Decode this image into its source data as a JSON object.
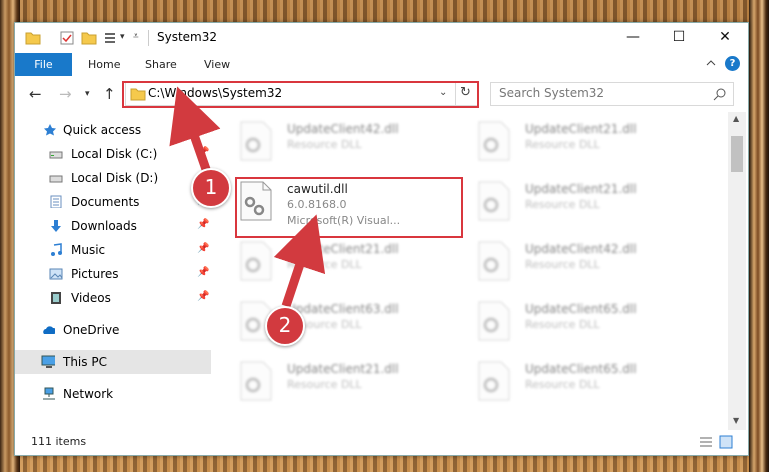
{
  "window": {
    "title": "System32",
    "controls": {
      "minimize": "—",
      "maximize": "☐",
      "close": "✕"
    }
  },
  "ribbon": {
    "tabs": [
      "File",
      "Home",
      "Share",
      "View"
    ],
    "help": "?"
  },
  "addressbar": {
    "path": "C:\\Windows\\System32",
    "search_placeholder": "Search System32"
  },
  "sidebar": {
    "items": [
      {
        "label": "Quick access",
        "icon": "star-icon"
      },
      {
        "label": "Local Disk (C:)",
        "icon": "drive-icon"
      },
      {
        "label": "Local Disk (D:)",
        "icon": "drive-icon"
      },
      {
        "label": "Documents",
        "icon": "documents-icon"
      },
      {
        "label": "Downloads",
        "icon": "download-icon"
      },
      {
        "label": "Music",
        "icon": "music-icon"
      },
      {
        "label": "Pictures",
        "icon": "pictures-icon"
      },
      {
        "label": "Videos",
        "icon": "videos-icon"
      },
      {
        "label": "OneDrive",
        "icon": "cloud-icon"
      },
      {
        "label": "This PC",
        "icon": "computer-icon",
        "selected": true
      },
      {
        "label": "Network",
        "icon": "network-icon"
      }
    ]
  },
  "files": [
    {
      "name": "UpdateClient42.dll",
      "type": "Resource DLL"
    },
    {
      "name": "UpdateClient21.dll",
      "type": "Resource DLL"
    },
    {
      "name": "cawutil.dll",
      "version": "6.0.8168.0",
      "company": "Microsoft(R) Visual...",
      "highlighted": true
    },
    {
      "name": "UpdateClient21.dll",
      "type": "Resource DLL"
    },
    {
      "name": "UpdateClient21.dll",
      "type": "Resource DLL"
    },
    {
      "name": "UpdateClient42.dll",
      "type": "Resource DLL"
    },
    {
      "name": "UpdateClient63.dll",
      "type": "Resource DLL"
    },
    {
      "name": "UpdateClient65.dll",
      "type": "Resource DLL"
    },
    {
      "name": "UpdateClient21.dll",
      "type": "Resource DLL"
    },
    {
      "name": "UpdateClient65.dll",
      "type": "Resource DLL"
    }
  ],
  "status": {
    "item_count": "111 items"
  },
  "annotations": {
    "marker1": "1",
    "marker2": "2",
    "color": "#d9363e"
  }
}
